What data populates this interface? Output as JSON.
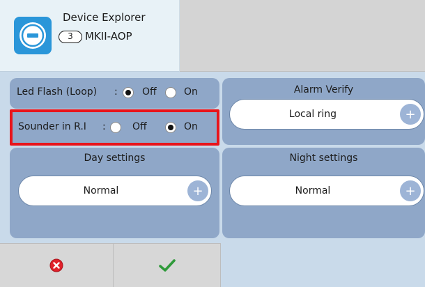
{
  "header": {
    "title": "Device Explorer",
    "address": "3",
    "model": "MKII-AOP"
  },
  "led_flash": {
    "label": "Led Flash (Loop)",
    "sep": ":",
    "options": [
      {
        "label": "Off",
        "selected": true
      },
      {
        "label": "On",
        "selected": false
      }
    ]
  },
  "sounder": {
    "label": "Sounder in R.I",
    "sep": ":",
    "options": [
      {
        "label": "Off",
        "selected": false
      },
      {
        "label": "On",
        "selected": true
      }
    ]
  },
  "alarm_verify": {
    "title": "Alarm Verify",
    "value": "Local ring"
  },
  "day_settings": {
    "title": "Day settings",
    "value": "Normal"
  },
  "night_settings": {
    "title": "Night settings",
    "value": "Normal"
  },
  "plus_glyph": "+",
  "footer": {
    "cancel_icon": "cancel-icon",
    "confirm_icon": "check-icon"
  },
  "colors": {
    "panel": "#8fa7c8",
    "highlight": "#e8141b",
    "accent": "#2a96d9"
  }
}
